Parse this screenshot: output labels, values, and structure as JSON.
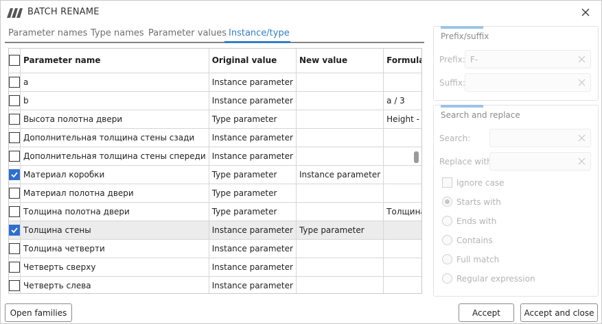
{
  "window": {
    "title": "BATCH RENAME"
  },
  "tabs": [
    {
      "label": "Parameter names",
      "active": false
    },
    {
      "label": "Type names",
      "active": false
    },
    {
      "label": "Parameter values",
      "active": false
    },
    {
      "label": "Instance/type",
      "active": true
    }
  ],
  "table": {
    "columns": [
      "Parameter name",
      "Original value",
      "New value",
      "Formula"
    ],
    "rows": [
      {
        "checked": false,
        "name": "a",
        "original": "Instance parameter",
        "new": "",
        "formula": ""
      },
      {
        "checked": false,
        "name": "b",
        "original": "Instance parameter",
        "new": "",
        "formula": "a / 3"
      },
      {
        "checked": false,
        "name": "Высота полотна двери",
        "original": "Type parameter",
        "new": "",
        "formula": "Height - Зазор -"
      },
      {
        "checked": false,
        "name": "Дополнительная толщина стены сзади",
        "original": "Instance parameter",
        "new": "",
        "formula": ""
      },
      {
        "checked": false,
        "name": "Дополнительная толщина стены спереди",
        "original": "Instance parameter",
        "new": "",
        "formula": ""
      },
      {
        "checked": true,
        "name": "Материал коробки",
        "original": "Type parameter",
        "new": "Instance parameter",
        "formula": ""
      },
      {
        "checked": false,
        "name": "Материал полотна двери",
        "original": "Type parameter",
        "new": "",
        "formula": ""
      },
      {
        "checked": false,
        "name": "Толщина полотна двери",
        "original": "Type parameter",
        "new": "",
        "formula": "Толщина короб"
      },
      {
        "checked": true,
        "name": "Толщина стены",
        "original": "Instance parameter",
        "new": "Type parameter",
        "formula": "",
        "selected": true
      },
      {
        "checked": false,
        "name": "Толщина четверти",
        "original": "Instance parameter",
        "new": "",
        "formula": ""
      },
      {
        "checked": false,
        "name": "Четверть сверху",
        "original": "Instance parameter",
        "new": "",
        "formula": ""
      },
      {
        "checked": false,
        "name": "Четверть слева",
        "original": "Instance parameter",
        "new": "",
        "formula": ""
      }
    ]
  },
  "prefix_suffix": {
    "title": "Prefix/suffix",
    "prefix_label": "Prefix:",
    "prefix_value": "F-",
    "suffix_label": "Suffix:",
    "suffix_value": ""
  },
  "search_replace": {
    "title": "Search and replace",
    "search_label": "Search:",
    "search_value": "",
    "replace_label": "Replace with:",
    "replace_value": "",
    "ignore_case_label": "Ignore case",
    "ignore_case_checked": false,
    "options": [
      {
        "label": "Starts with",
        "selected": true
      },
      {
        "label": "Ends with",
        "selected": false
      },
      {
        "label": "Contains",
        "selected": false
      },
      {
        "label": "Full match",
        "selected": false
      },
      {
        "label": "Regular expression",
        "selected": false
      }
    ]
  },
  "buttons": {
    "open_families": "Open families",
    "accept": "Accept",
    "accept_close": "Accept and close"
  },
  "colors": {
    "accent": "#2f80c8",
    "checkbox_checked": "#2f6ecf",
    "selected_row": "#ececec"
  }
}
